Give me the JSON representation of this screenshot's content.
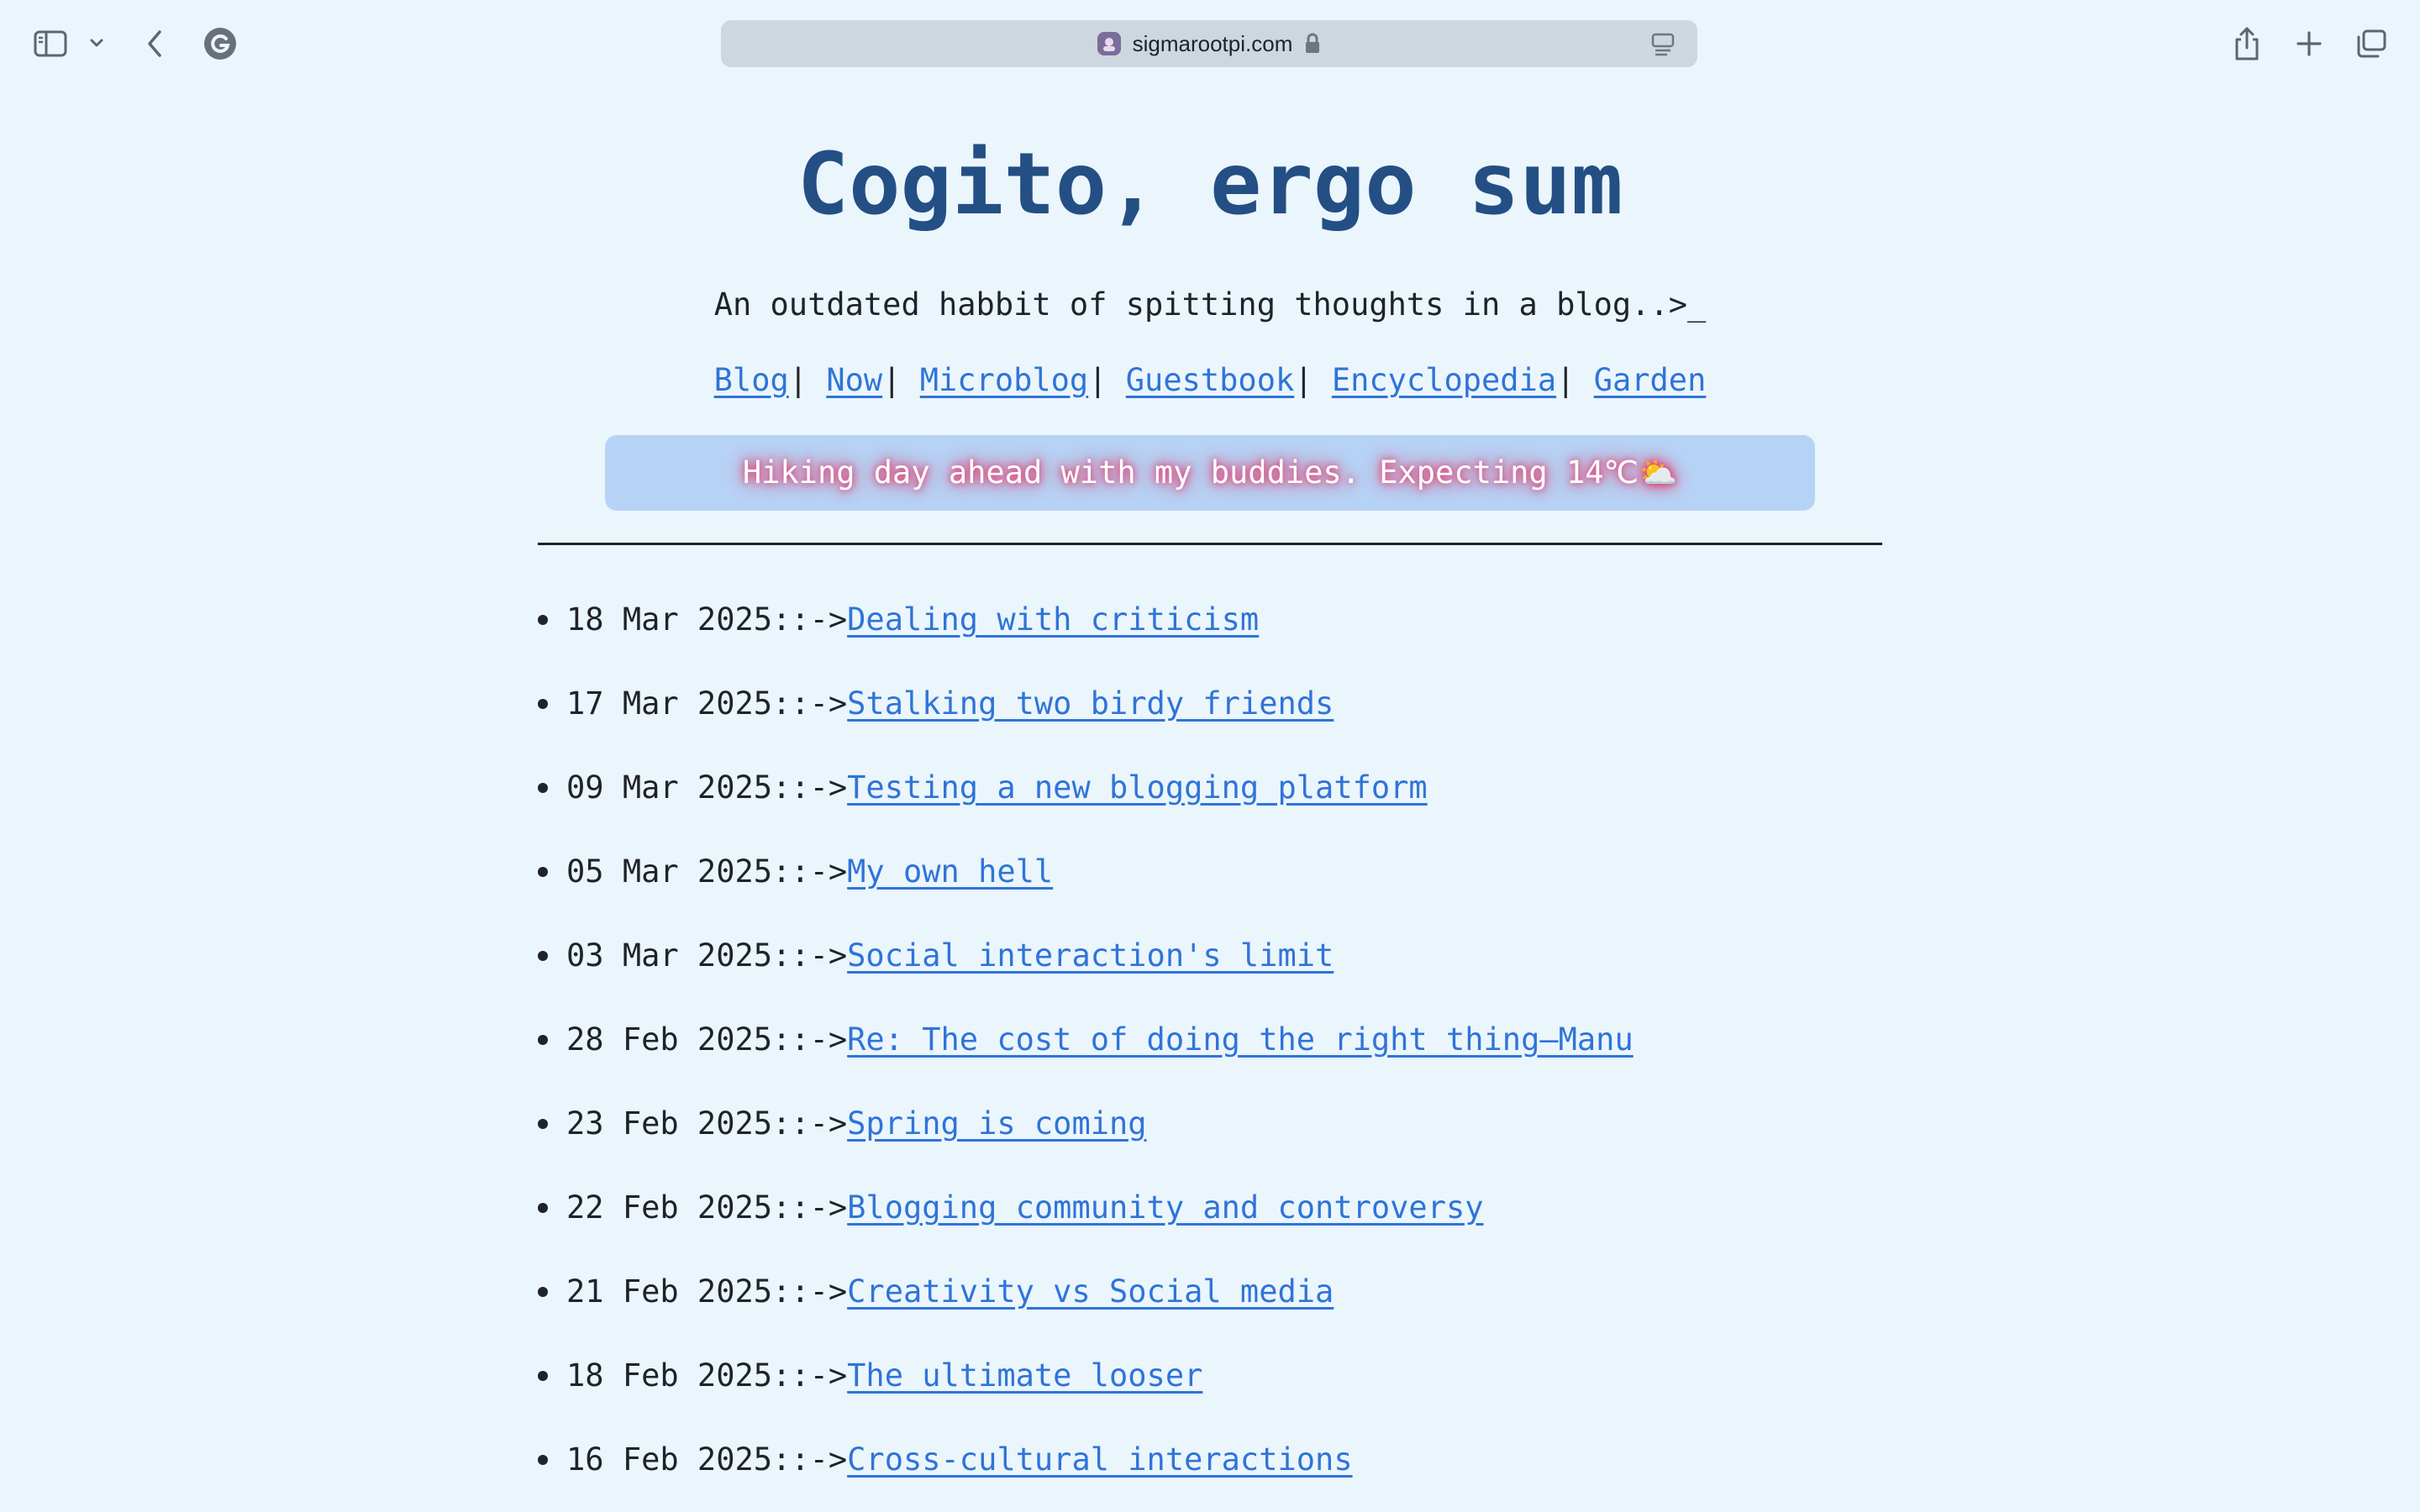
{
  "browser": {
    "url": "sigmarootpi.com",
    "icons": {
      "sidebar": "sidebar-icon",
      "sidebar_menu": "chevron-down-icon",
      "back": "back-arrow-icon",
      "extension": "grammarly-icon",
      "favicon": "site-favicon-icon",
      "lock": "lock-icon",
      "reader": "reader-mode-icon",
      "share": "share-icon",
      "new_tab": "plus-icon",
      "tab_overview": "tab-overview-icon"
    }
  },
  "header": {
    "title": "Cogito, ergo sum",
    "tagline": "An outdated habbit of spitting thoughts in a blog..>_"
  },
  "nav": {
    "items": [
      {
        "label": "Blog"
      },
      {
        "label": "Now"
      },
      {
        "label": "Microblog"
      },
      {
        "label": "Guestbook"
      },
      {
        "label": "Encyclopedia"
      },
      {
        "label": "Garden"
      }
    ],
    "separator": "|"
  },
  "status": {
    "text": "Hiking day ahead with my buddies. Expecting 14℃⛅"
  },
  "posts": [
    {
      "date": "18 Mar 2025::->",
      "title": "Dealing with criticism"
    },
    {
      "date": "17 Mar 2025::->",
      "title": "Stalking two birdy friends"
    },
    {
      "date": "09 Mar 2025::->",
      "title": "Testing a new blogging platform"
    },
    {
      "date": "05 Mar 2025::->",
      "title": "My own hell"
    },
    {
      "date": "03 Mar 2025::->",
      "title": "Social interaction's limit"
    },
    {
      "date": "28 Feb 2025::->",
      "title": "Re: The cost of doing the right thing—Manu"
    },
    {
      "date": "23 Feb 2025::->",
      "title": "Spring is coming"
    },
    {
      "date": "22 Feb 2025::->",
      "title": "Blogging community and controversy"
    },
    {
      "date": "21 Feb 2025::->",
      "title": "Creativity vs Social media"
    },
    {
      "date": "18 Feb 2025::->",
      "title": "The ultimate looser"
    },
    {
      "date": "16 Feb 2025::->",
      "title": "Cross-cultural interactions"
    }
  ],
  "colors": {
    "background": "#ebf5fc",
    "title": "#234f84",
    "link": "#2f74d8",
    "status_box": "#b6d3f6",
    "status_glow": "#d9386e"
  }
}
